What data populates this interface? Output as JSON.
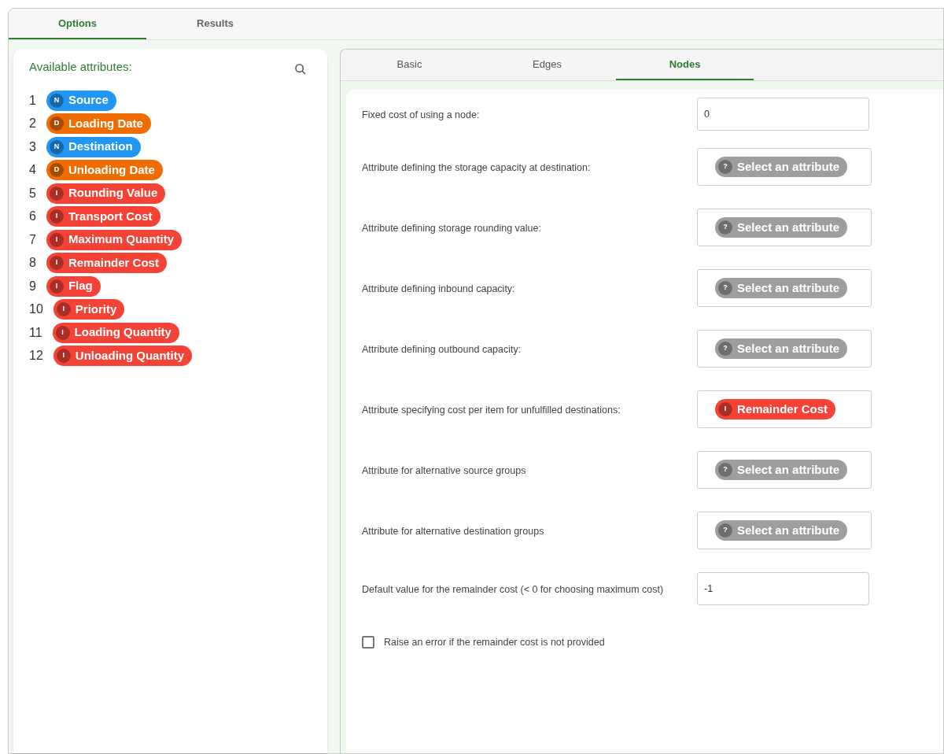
{
  "main_tabs": [
    {
      "label": "Options",
      "selected": true
    },
    {
      "label": "Results",
      "selected": false
    }
  ],
  "attributes_panel": {
    "title": "Available attributes:",
    "items": [
      {
        "index": "1",
        "badge": "N",
        "label": "Source",
        "color": "#2196f3"
      },
      {
        "index": "2",
        "badge": "D",
        "label": "Loading Date",
        "color": "#ef6c00"
      },
      {
        "index": "3",
        "badge": "N",
        "label": "Destination",
        "color": "#2196f3"
      },
      {
        "index": "4",
        "badge": "D",
        "label": "Unloading Date",
        "color": "#ef6c00"
      },
      {
        "index": "5",
        "badge": "I",
        "label": "Rounding Value",
        "color": "#f44336"
      },
      {
        "index": "6",
        "badge": "I",
        "label": "Transport Cost",
        "color": "#f44336"
      },
      {
        "index": "7",
        "badge": "I",
        "label": "Maximum Quantity",
        "color": "#f44336"
      },
      {
        "index": "8",
        "badge": "I",
        "label": "Remainder Cost",
        "color": "#f44336"
      },
      {
        "index": "9",
        "badge": "I",
        "label": "Flag",
        "color": "#f44336"
      },
      {
        "index": "10",
        "badge": "I",
        "label": "Priority",
        "color": "#f44336"
      },
      {
        "index": "11",
        "badge": "I",
        "label": "Loading Quantity",
        "color": "#f44336"
      },
      {
        "index": "12",
        "badge": "I",
        "label": "Unloading Quantity",
        "color": "#f44336"
      }
    ]
  },
  "sub_tabs": [
    {
      "label": "Basic",
      "selected": false
    },
    {
      "label": "Edges",
      "selected": false
    },
    {
      "label": "Nodes",
      "selected": true
    }
  ],
  "settings": [
    {
      "kind": "input",
      "label": "Fixed cost of using a node:",
      "value": "0"
    },
    {
      "kind": "attribute",
      "label": "Attribute defining the storage capacity at destination:",
      "badge": "?",
      "chip": "Select an attribute",
      "color": "#9e9e9e"
    },
    {
      "kind": "attribute",
      "label": "Attribute defining storage rounding value:",
      "badge": "?",
      "chip": "Select an attribute",
      "color": "#9e9e9e"
    },
    {
      "kind": "attribute",
      "label": "Attribute defining inbound capacity:",
      "badge": "?",
      "chip": "Select an attribute",
      "color": "#9e9e9e"
    },
    {
      "kind": "attribute",
      "label": "Attribute defining outbound capacity:",
      "badge": "?",
      "chip": "Select an attribute",
      "color": "#9e9e9e"
    },
    {
      "kind": "attribute",
      "label": "Attribute specifying cost per item for unfulfilled destinations:",
      "badge": "I",
      "chip": "Remainder Cost",
      "color": "#f44336"
    },
    {
      "kind": "attribute",
      "label": "Attribute for alternative source groups",
      "badge": "?",
      "chip": "Select an attribute",
      "color": "#9e9e9e"
    },
    {
      "kind": "attribute",
      "label": "Attribute for alternative destination groups",
      "badge": "?",
      "chip": "Select an attribute",
      "color": "#9e9e9e"
    },
    {
      "kind": "input",
      "label": "Default value for the remainder cost (< 0 for choosing maximum cost)",
      "value": "-1"
    },
    {
      "kind": "checkbox",
      "label": "Raise an error if the remainder cost is not provided",
      "checked": false
    }
  ]
}
